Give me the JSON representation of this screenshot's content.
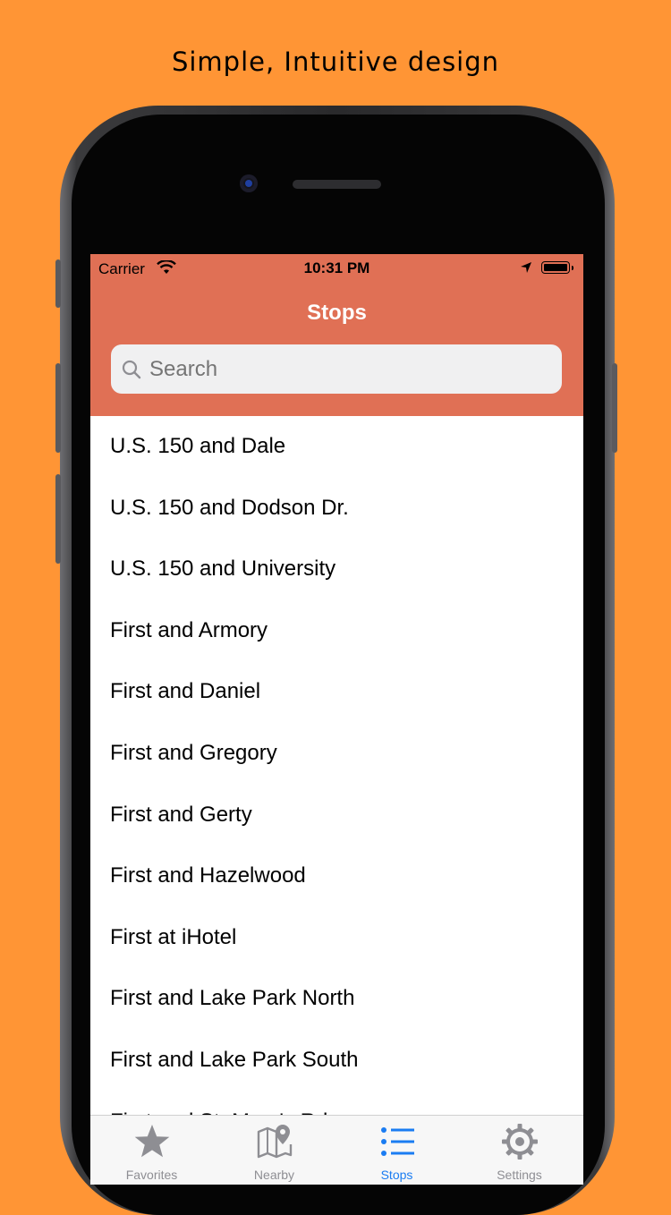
{
  "promo": {
    "caption": "Simple, Intuitive design"
  },
  "status_bar": {
    "carrier": "Carrier",
    "time": "10:31 PM"
  },
  "nav": {
    "title": "Stops"
  },
  "search": {
    "placeholder": "Search"
  },
  "stops": [
    "U.S. 150 and Dale",
    "U.S. 150 and Dodson Dr.",
    "U.S. 150 and University",
    "First and Armory",
    "First and Daniel",
    "First and Gregory",
    "First and Gerty",
    "First and Hazelwood",
    "First at iHotel",
    "First and Lake Park North",
    "First and Lake Park South",
    "First and St. Mary's Rd."
  ],
  "tabs": [
    {
      "label": "Favorites",
      "icon": "star-icon",
      "active": false
    },
    {
      "label": "Nearby",
      "icon": "map-pin-icon",
      "active": false
    },
    {
      "label": "Stops",
      "icon": "list-icon",
      "active": true
    },
    {
      "label": "Settings",
      "icon": "gear-icon",
      "active": false
    }
  ],
  "colors": {
    "background": "#FF9535",
    "nav_bar": "#E07055",
    "tab_active": "#1a7cf2",
    "tab_inactive": "#8e8e93"
  }
}
